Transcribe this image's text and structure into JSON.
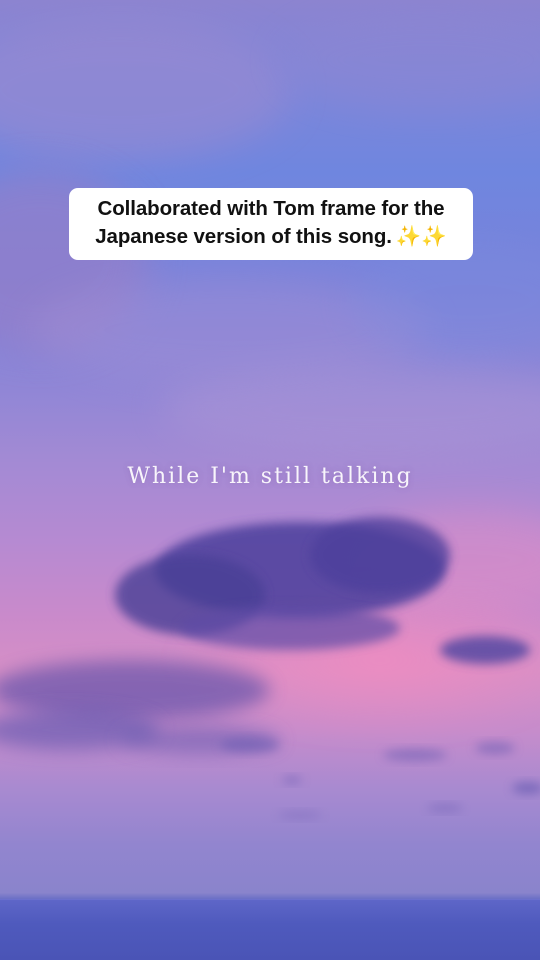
{
  "caption": {
    "line1": "Collaborated with Tom frame for the",
    "line2": "Japanese version of this song.",
    "emoji": "✨✨"
  },
  "lyric": {
    "text": "While I'm still talking"
  },
  "colors": {
    "sky_top": "#8c84d0",
    "sky_blue": "#6f86df",
    "sunset_pink": "#d68fc6",
    "cloud_purple": "#4a3f9e",
    "sea": "#4f5abd"
  }
}
